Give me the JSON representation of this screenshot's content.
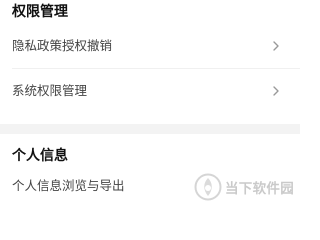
{
  "sections": [
    {
      "title": "权限管理",
      "items": [
        {
          "label": "隐私政策授权撤销",
          "has_chevron": true
        },
        {
          "label": "系统权限管理",
          "has_chevron": true
        }
      ]
    },
    {
      "title": "个人信息",
      "items": [
        {
          "label": "个人信息浏览与导出",
          "has_chevron": true
        }
      ]
    }
  ],
  "watermark": {
    "text": "当下软件园",
    "icon": "dangxia-logo-icon"
  },
  "colors": {
    "background": "#ffffff",
    "section_gap": "#f3f3f3",
    "title": "#111111",
    "item_text": "#444444",
    "chevron": "#999999",
    "watermark_text": "#b9b9b9"
  }
}
